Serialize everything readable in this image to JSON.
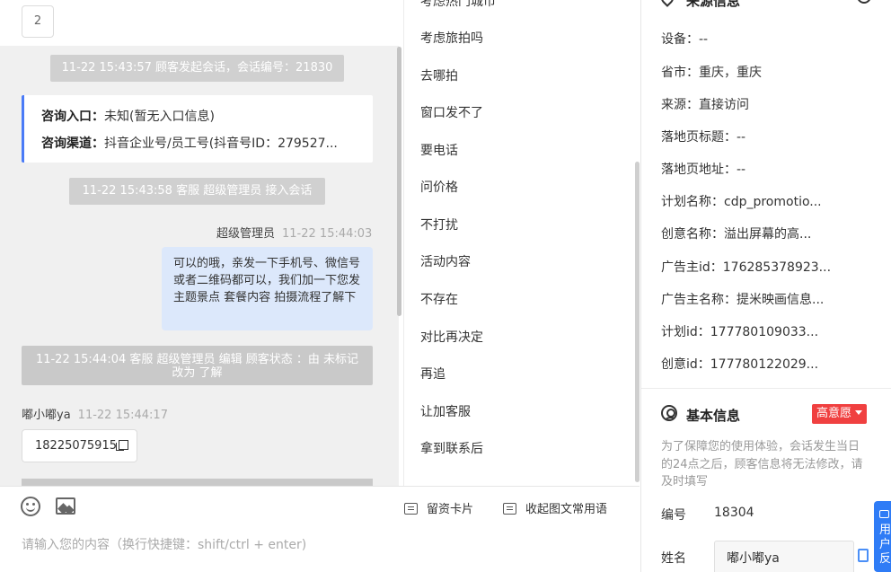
{
  "chat": {
    "top_chip": "2",
    "session_start": "11-22 15:43:57 顾客发起会话，会话编号：21830",
    "info_card": {
      "entry_label": "咨询入口：",
      "entry_value": "未知(暂无入口信息)",
      "channel_label": "咨询渠道：",
      "channel_value": "抖音企业号/员工号(抖音号ID：279527..."
    },
    "agent_join": "11-22 15:43:58 客服 超级管理员 接入会话",
    "agent_message": {
      "sender": "超级管理员",
      "time": "11-22 15:44:03",
      "text": "可以的哦，亲发一下手机号、微信号或者二维码都可以，我们加一下您发主题景点 套餐内容 拍摄流程了解下"
    },
    "status_edit": "11-22 15:44:04 客服 超级管理员 编辑 顾客状态 ：由 未标记 改为 了解",
    "customer_message": {
      "sender": "嘟小嘟ya",
      "time": "11-22 15:44:17",
      "text": "18225075915"
    }
  },
  "composer": {
    "lead_card_label": "留资卡片",
    "collapse_label": "收起图文常用语",
    "placeholder": "请输入您的内容（换行快捷键：shift/ctrl + enter)"
  },
  "phrases": [
    "考虑热门城市",
    "考虑旅拍吗",
    "去哪拍",
    "窗口发不了",
    "要电话",
    "问价格",
    "不打扰",
    "活动内容",
    "不存在",
    "对比再决定",
    "再追",
    "让加客服",
    "拿到联系后"
  ],
  "source_info": {
    "title": "来源信息",
    "rows": [
      "设备：--",
      "省市：重庆，重庆",
      "来源：直接访问",
      "落地页标题：--",
      "落地页地址：--",
      "计划名称：cdp_promotio...",
      "创意名称：溢出屏幕的高...",
      "广告主id：176285378923...",
      "广告主名称：提米映画信息...",
      "计划id：177780109033...",
      "创意id：177780122029..."
    ]
  },
  "basic_info": {
    "title": "基本信息",
    "intent_badge": "高意愿",
    "hint": "为了保障您的使用体验，会话发生当日的24点之后，顾客信息将无法修改，请及时填写",
    "id_label": "编号",
    "id_value": "18304",
    "name_label": "姓名",
    "name_value": "嘟小嘟ya"
  },
  "float_button": "用户反"
}
